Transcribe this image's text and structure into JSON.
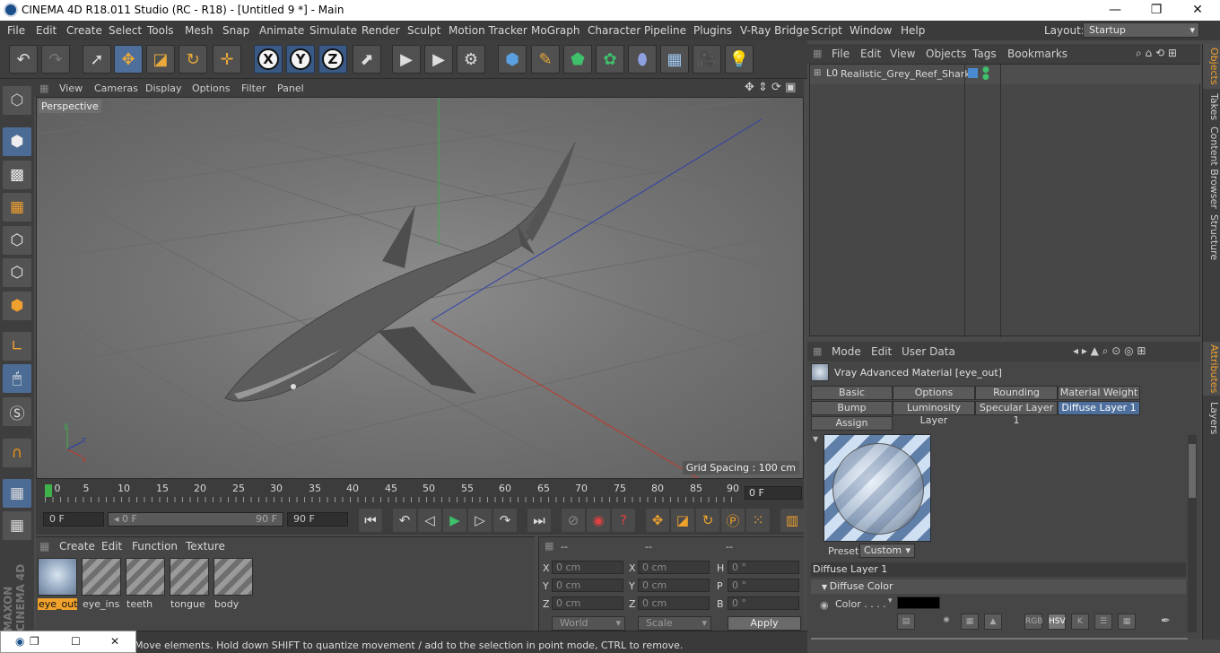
{
  "titlebar": {
    "title": "CINEMA 4D R18.011 Studio (RC - R18) - [Untitled 9 *] - Main",
    "minimize": "—",
    "restore": "❐",
    "close": "✕"
  },
  "menubar": {
    "items": [
      "File",
      "Edit",
      "Create",
      "Select",
      "Tools",
      "Mesh",
      "Snap",
      "Animate",
      "Simulate",
      "Render",
      "Sculpt",
      "Motion Tracker",
      "MoGraph",
      "Character",
      "Pipeline",
      "Plugins",
      "V-Ray Bridge",
      "Script",
      "Window",
      "Help"
    ],
    "layout_label": "Layout:",
    "layout_value": "Startup"
  },
  "toolbar": {
    "undo": "↶",
    "redo": "↷",
    "axis_x": "X",
    "axis_y": "Y",
    "axis_z": "Z"
  },
  "viewport": {
    "menu": [
      "View",
      "Cameras",
      "Display",
      "Options",
      "Filter",
      "Panel"
    ],
    "label": "Perspective",
    "grid_spacing": "Grid Spacing : 100 cm"
  },
  "timeline": {
    "ticks": [
      "0",
      "5",
      "10",
      "15",
      "20",
      "25",
      "30",
      "35",
      "40",
      "45",
      "50",
      "55",
      "60",
      "65",
      "70",
      "75",
      "80",
      "85",
      "90"
    ],
    "frame_end": "0 F",
    "start_field": "0 F",
    "range_start": "◂ 0 F",
    "range_end": "90 F",
    "end_field": "90 F"
  },
  "materials": {
    "menu": [
      "Create",
      "Edit",
      "Function",
      "Texture"
    ],
    "items": [
      "eye_out",
      "eye_ins",
      "teeth",
      "tongue",
      "body"
    ]
  },
  "coords": {
    "headers": [
      "--",
      "--",
      "--"
    ],
    "labels_left": [
      "X",
      "Y",
      "Z"
    ],
    "labels_mid": [
      "X",
      "Y",
      "Z"
    ],
    "labels_right": [
      "H",
      "P",
      "B"
    ],
    "pos": [
      "0 cm",
      "0 cm",
      "0 cm"
    ],
    "size": [
      "0 cm",
      "0 cm",
      "0 cm"
    ],
    "rot": [
      "0 °",
      "0 °",
      "0 °"
    ],
    "world": "World",
    "scale": "Scale",
    "apply": "Apply"
  },
  "status": {
    "text": "Move elements. Hold down SHIFT to quantize movement / add to the selection in point mode, CTRL to remove."
  },
  "objects": {
    "menu": [
      "File",
      "Edit",
      "View",
      "Objects",
      "Tags",
      "Bookmarks"
    ],
    "object_name": "Realistic_Grey_Reef_Shark"
  },
  "right_tabs": [
    "Objects",
    "Takes",
    "Content Browser",
    "Structure",
    "Attributes",
    "Layers"
  ],
  "attributes": {
    "menu": [
      "Mode",
      "Edit",
      "User Data"
    ],
    "material_title": "Vray Advanced Material [eye_out]",
    "tabs": [
      "Basic",
      "Options",
      "Rounding",
      "Material Weight",
      "Bump",
      "Luminosity Layer",
      "Specular Layer 1",
      "Diffuse Layer 1",
      "Assign"
    ],
    "preset_label": "Preset",
    "preset_value": "Custom",
    "section_title": "Diffuse Layer 1",
    "subsection": "Diffuse Color",
    "color_label": "Color . . . .",
    "color_value": "#000000",
    "mode_chips": [
      "RGB",
      "HSV",
      "K"
    ]
  },
  "colors": {
    "accent": "#f0a22c",
    "selection_blue": "#4e6f9c",
    "axis_green": "#3fb14a",
    "axis_red": "#c0392b",
    "axis_blue": "#2d3ea8"
  }
}
